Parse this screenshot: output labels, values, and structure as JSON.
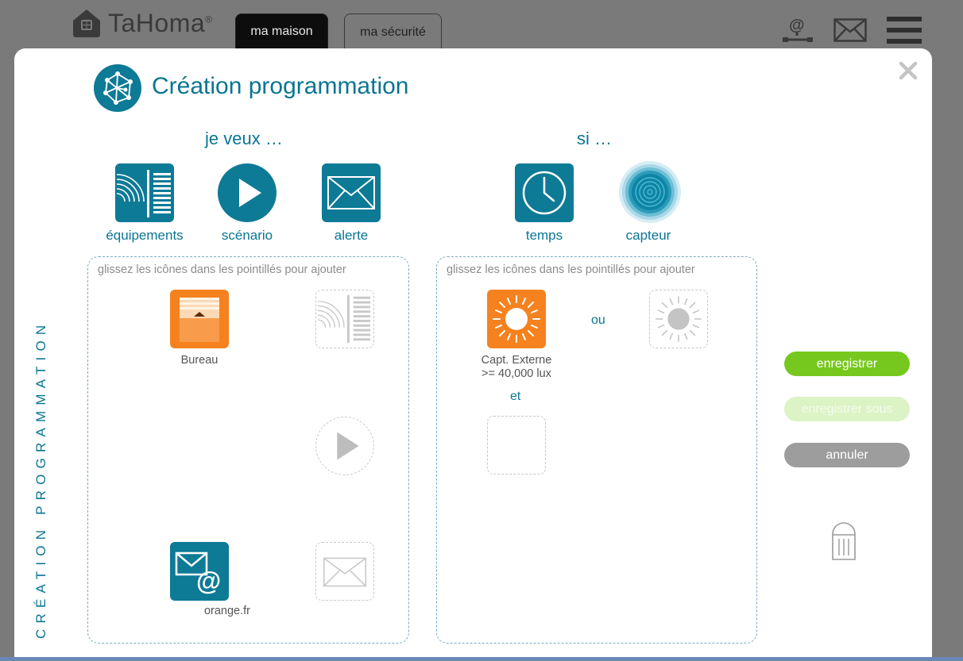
{
  "app": {
    "logo_text": "TaHoma",
    "logo_mark": "®"
  },
  "tabs": [
    {
      "label": "ma maison",
      "active": true
    },
    {
      "label": "ma sécurité",
      "active": false
    }
  ],
  "top_icons": [
    "at-network-icon",
    "mail-icon",
    "menu-icon"
  ],
  "modal": {
    "title": "Création programmation",
    "vertical_label": "CRÉATION PROGRAMMATION",
    "left": {
      "heading": "je veux …",
      "palette": [
        {
          "label": "équipements",
          "icon": "shutter-icon"
        },
        {
          "label": "scénario",
          "icon": "play-icon"
        },
        {
          "label": "alerte",
          "icon": "envelope-icon"
        }
      ],
      "hint": "glissez les icônes dans les pointillés pour ajouter",
      "items": [
        {
          "label": "Bureau",
          "icon": "awning-icon"
        },
        {
          "label": "orange.fr",
          "icon": "email-at-icon"
        }
      ]
    },
    "right": {
      "heading": "si …",
      "palette": [
        {
          "label": "temps",
          "icon": "clock-icon"
        },
        {
          "label": "capteur",
          "icon": "sensor-icon"
        }
      ],
      "hint": "glissez les icônes dans les pointillés pour ajouter",
      "condition": {
        "line1": "Capt. Externe",
        "line2": ">= 40,000 lux",
        "icon": "sun-icon"
      },
      "or_label": "ou",
      "and_label": "et"
    },
    "buttons": {
      "save": "enregistrer",
      "save_as": "enregistrer sous",
      "cancel": "annuler"
    }
  },
  "colors": {
    "brand": "#0a7593",
    "tile": "#0d7a96",
    "accent_orange": "#f5821f",
    "save_green": "#77c81e"
  }
}
